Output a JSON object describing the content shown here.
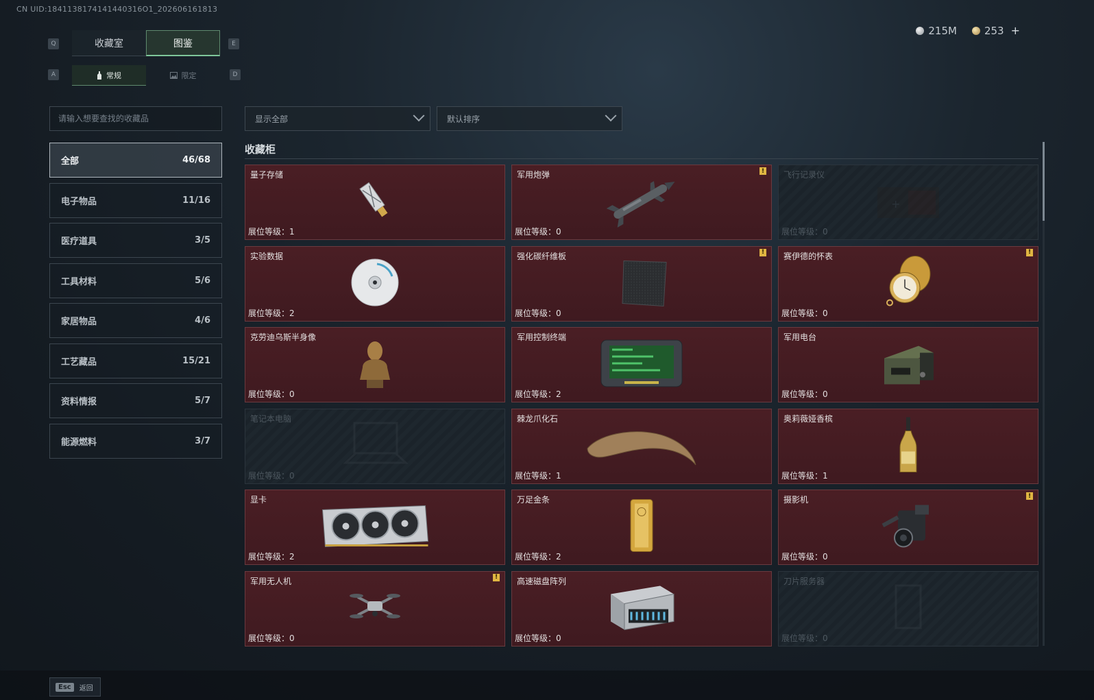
{
  "uid": "CN UID:1841138174141440316O1_202606161813",
  "currency": {
    "silver": "215M",
    "gold": "253",
    "plus": "+"
  },
  "keys": {
    "prev_tab": "Q",
    "next_tab": "E",
    "prev_sub": "A",
    "next_sub": "D"
  },
  "tabs": [
    {
      "label": "收藏室",
      "active": false
    },
    {
      "label": "图鉴",
      "active": true
    }
  ],
  "subtabs": [
    {
      "label": "常规",
      "active": true
    },
    {
      "label": "限定",
      "active": false
    }
  ],
  "search": {
    "placeholder": "请输入想要查找的收藏品"
  },
  "filters": {
    "show": "显示全部",
    "sort": "默认排序"
  },
  "categories": [
    {
      "label": "全部",
      "count": "46/68",
      "active": true
    },
    {
      "label": "电子物品",
      "count": "11/16"
    },
    {
      "label": "医疗道具",
      "count": "3/5"
    },
    {
      "label": "工具材料",
      "count": "5/6"
    },
    {
      "label": "家居物品",
      "count": "4/6"
    },
    {
      "label": "工艺藏品",
      "count": "15/21"
    },
    {
      "label": "资料情报",
      "count": "5/7"
    },
    {
      "label": "能源燃料",
      "count": "3/7"
    }
  ],
  "section_title": "收藏柜",
  "level_label": "展位等级：",
  "alert_mark": "!",
  "items": [
    {
      "name": "量子存储",
      "level": "1",
      "locked": false,
      "alert": false,
      "icon": "usb-drive-icon"
    },
    {
      "name": "军用炮弹",
      "level": "0",
      "locked": false,
      "alert": true,
      "icon": "missile-icon"
    },
    {
      "name": "飞行记录仪",
      "level": "0",
      "locked": true,
      "alert": false,
      "icon": "flight-recorder-icon"
    },
    {
      "name": "实验数据",
      "level": "2",
      "locked": false,
      "alert": false,
      "icon": "disc-icon"
    },
    {
      "name": "强化碳纤维板",
      "level": "0",
      "locked": false,
      "alert": true,
      "icon": "carbon-plate-icon"
    },
    {
      "name": "赛伊德的怀表",
      "level": "0",
      "locked": false,
      "alert": true,
      "icon": "pocket-watch-icon"
    },
    {
      "name": "克劳迪乌斯半身像",
      "level": "0",
      "locked": false,
      "alert": false,
      "icon": "bust-icon"
    },
    {
      "name": "军用控制终端",
      "level": "2",
      "locked": false,
      "alert": false,
      "icon": "terminal-icon"
    },
    {
      "name": "军用电台",
      "level": "0",
      "locked": false,
      "alert": false,
      "icon": "radio-icon"
    },
    {
      "name": "笔记本电脑",
      "level": "0",
      "locked": true,
      "alert": false,
      "icon": "laptop-icon"
    },
    {
      "name": "棘龙爪化石",
      "level": "1",
      "locked": false,
      "alert": false,
      "icon": "claw-fossil-icon"
    },
    {
      "name": "奥莉薇娅香槟",
      "level": "1",
      "locked": false,
      "alert": false,
      "icon": "champagne-icon"
    },
    {
      "name": "显卡",
      "level": "2",
      "locked": false,
      "alert": false,
      "icon": "graphics-card-icon"
    },
    {
      "name": "万足金条",
      "level": "2",
      "locked": false,
      "alert": false,
      "icon": "gold-bar-icon"
    },
    {
      "name": "摄影机",
      "level": "0",
      "locked": false,
      "alert": true,
      "icon": "camera-icon"
    },
    {
      "name": "军用无人机",
      "level": "0",
      "locked": false,
      "alert": true,
      "icon": "drone-icon"
    },
    {
      "name": "高速磁盘阵列",
      "level": "0",
      "locked": false,
      "alert": false,
      "icon": "disk-array-icon"
    },
    {
      "name": "刀片服务器",
      "level": "0",
      "locked": true,
      "alert": false,
      "icon": "blade-server-icon"
    }
  ],
  "footer": {
    "key": "Esc",
    "label": "返回"
  }
}
